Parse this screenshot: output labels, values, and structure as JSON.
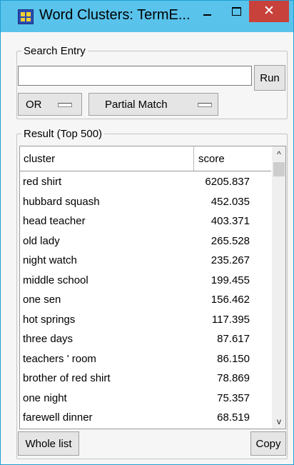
{
  "window": {
    "title": "Word Clusters: TermE...",
    "close_glyph": "✕",
    "accent_color": "#59c3ec",
    "close_color": "#c8413b"
  },
  "search": {
    "group_label": "Search Entry",
    "input_value": "",
    "run_label": "Run",
    "operator_value": "OR",
    "match_value": "Partial Match"
  },
  "result": {
    "group_label": "Result (Top 500)",
    "columns": [
      "cluster",
      "score"
    ],
    "rows": [
      {
        "cluster": "red shirt",
        "score": "6205.837"
      },
      {
        "cluster": "hubbard squash",
        "score": "452.035"
      },
      {
        "cluster": "head teacher",
        "score": "403.371"
      },
      {
        "cluster": "old lady",
        "score": "265.528"
      },
      {
        "cluster": "night watch",
        "score": "235.267"
      },
      {
        "cluster": "middle school",
        "score": "199.455"
      },
      {
        "cluster": "one sen",
        "score": "156.462"
      },
      {
        "cluster": "hot springs",
        "score": "117.395"
      },
      {
        "cluster": "three days",
        "score": "87.617"
      },
      {
        "cluster": "teachers ' room",
        "score": "86.150"
      },
      {
        "cluster": "brother of red shirt",
        "score": "78.869"
      },
      {
        "cluster": "one night",
        "score": "75.357"
      },
      {
        "cluster": "farewell dinner",
        "score": "68.519"
      }
    ],
    "whole_list_label": "Whole list",
    "copy_label": "Copy"
  }
}
